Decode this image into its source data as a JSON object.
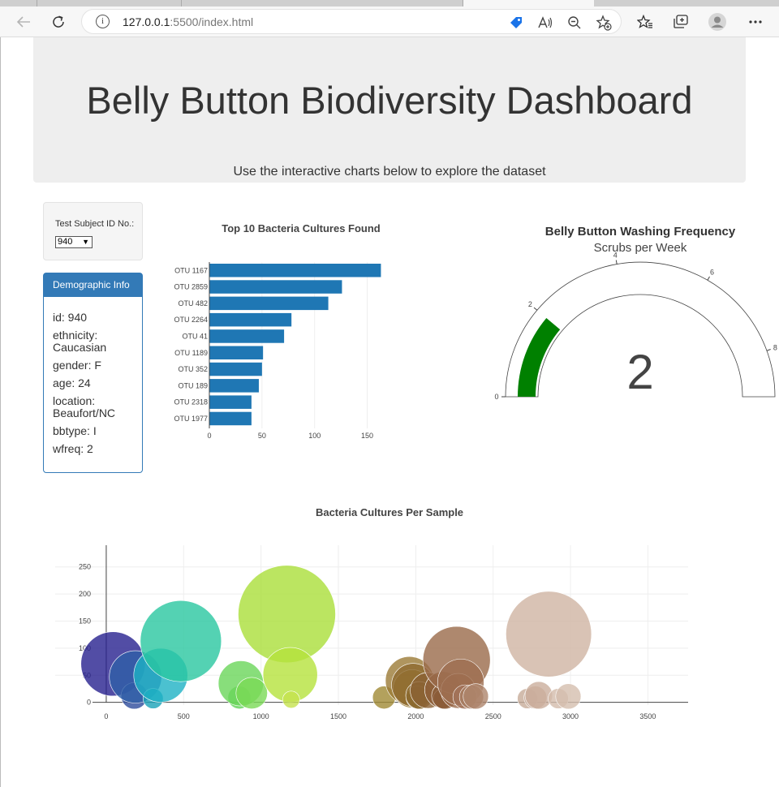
{
  "browser": {
    "url_host": "127.0.0.1",
    "url_path": ":5500/index.html"
  },
  "header": {
    "title": "Belly Button Biodiversity Dashboard",
    "subtitle": "Use the interactive charts below to explore the dataset"
  },
  "selector": {
    "label": "Test Subject ID No.:",
    "value": "940"
  },
  "demographic": {
    "heading": "Demographic Info",
    "id": "id: 940",
    "ethnicity": "ethnicity: Caucasian",
    "gender": "gender: F",
    "age": "age: 24",
    "location": "location: Beaufort/NC",
    "bbtype": "bbtype: I",
    "wfreq": "wfreq: 2"
  },
  "chart_data": [
    {
      "type": "bar",
      "orientation": "horizontal",
      "title": "Top 10 Bacteria Cultures Found",
      "color": "#1f77b4",
      "categories": [
        "OTU 1167",
        "OTU 2859",
        "OTU 482",
        "OTU 2264",
        "OTU 41",
        "OTU 1189",
        "OTU 352",
        "OTU 189",
        "OTU 2318",
        "OTU 1977"
      ],
      "values": [
        163,
        126,
        113,
        78,
        71,
        51,
        50,
        47,
        40,
        40
      ],
      "xlim": [
        0,
        175
      ],
      "xticks": [
        0,
        50,
        100,
        150
      ],
      "grid": true
    },
    {
      "type": "gauge",
      "title": "Belly Button Washing Frequency",
      "subtitle": "Scrubs per Week",
      "value": 2,
      "range": [
        0,
        9
      ],
      "ticks": [
        0,
        2,
        4,
        6,
        8
      ],
      "bar_color": "#008000"
    },
    {
      "type": "scatter",
      "title": "Bacteria Cultures Per Sample",
      "xlim": [
        -330,
        3760
      ],
      "ylim": [
        -5,
        290
      ],
      "xticks": [
        0,
        500,
        1000,
        1500,
        2000,
        2500,
        3000,
        3500
      ],
      "yticks": [
        0,
        50,
        100,
        150,
        200,
        250
      ],
      "grid": true,
      "bubbles": [
        {
          "x": 44,
          "y": 71,
          "size": 71,
          "color": "#27208f"
        },
        {
          "x": 181,
          "y": 12,
          "size": 12,
          "color": "#2e4c9c"
        },
        {
          "x": 189,
          "y": 47,
          "size": 47,
          "color": "#2f5fa8"
        },
        {
          "x": 303,
          "y": 7,
          "size": 7,
          "color": "#1aa3b8"
        },
        {
          "x": 352,
          "y": 50,
          "size": 50,
          "color": "#1eb1c4"
        },
        {
          "x": 482,
          "y": 113,
          "size": 113,
          "color": "#29c7a0"
        },
        {
          "x": 860,
          "y": 9,
          "size": 9,
          "color": "#62d358"
        },
        {
          "x": 870,
          "y": 35,
          "size": 35,
          "color": "#6ad65a"
        },
        {
          "x": 940,
          "y": 17,
          "size": 17,
          "color": "#7ada56"
        },
        {
          "x": 1167,
          "y": 163,
          "size": 163,
          "color": "#aadf3a"
        },
        {
          "x": 1189,
          "y": 51,
          "size": 51,
          "color": "#b5e23c"
        },
        {
          "x": 1195,
          "y": 5,
          "size": 5,
          "color": "#c6e24d"
        },
        {
          "x": 1795,
          "y": 9,
          "size": 9,
          "color": "#a08a35"
        },
        {
          "x": 1960,
          "y": 40,
          "size": 40,
          "color": "#9b7a36"
        },
        {
          "x": 1977,
          "y": 25,
          "size": 25,
          "color": "#9a7a33"
        },
        {
          "x": 1983,
          "y": 32,
          "size": 32,
          "color": "#8f6a2f"
        },
        {
          "x": 2011,
          "y": 9,
          "size": 9,
          "color": "#8a6a2f"
        },
        {
          "x": 2024,
          "y": 13,
          "size": 13,
          "color": "#8c6a30"
        },
        {
          "x": 2080,
          "y": 22,
          "size": 22,
          "color": "#8b6134"
        },
        {
          "x": 2176,
          "y": 23,
          "size": 23,
          "color": "#8f5f3a"
        },
        {
          "x": 2178,
          "y": 7,
          "size": 7,
          "color": "#8a5b35"
        },
        {
          "x": 2188,
          "y": 12,
          "size": 12,
          "color": "#8b5c38"
        },
        {
          "x": 2264,
          "y": 78,
          "size": 78,
          "color": "#9a6a4a"
        },
        {
          "x": 2275,
          "y": 21,
          "size": 21,
          "color": "#9c6c4c"
        },
        {
          "x": 2291,
          "y": 37,
          "size": 37,
          "color": "#9d6e50"
        },
        {
          "x": 2318,
          "y": 10,
          "size": 10,
          "color": "#a2735a"
        },
        {
          "x": 2360,
          "y": 10,
          "size": 10,
          "color": "#a97e63"
        },
        {
          "x": 2388,
          "y": 11,
          "size": 11,
          "color": "#ae856c"
        },
        {
          "x": 2722,
          "y": 7,
          "size": 7,
          "color": "#c7ab98"
        },
        {
          "x": 2773,
          "y": 9,
          "size": 9,
          "color": "#c9ae9c"
        },
        {
          "x": 2795,
          "y": 13,
          "size": 13,
          "color": "#caae9c"
        },
        {
          "x": 2859,
          "y": 126,
          "size": 126,
          "color": "#cfb4a3"
        },
        {
          "x": 2921,
          "y": 7,
          "size": 7,
          "color": "#d3bcab"
        },
        {
          "x": 2986,
          "y": 11,
          "size": 11,
          "color": "#d5beae"
        }
      ]
    }
  ]
}
